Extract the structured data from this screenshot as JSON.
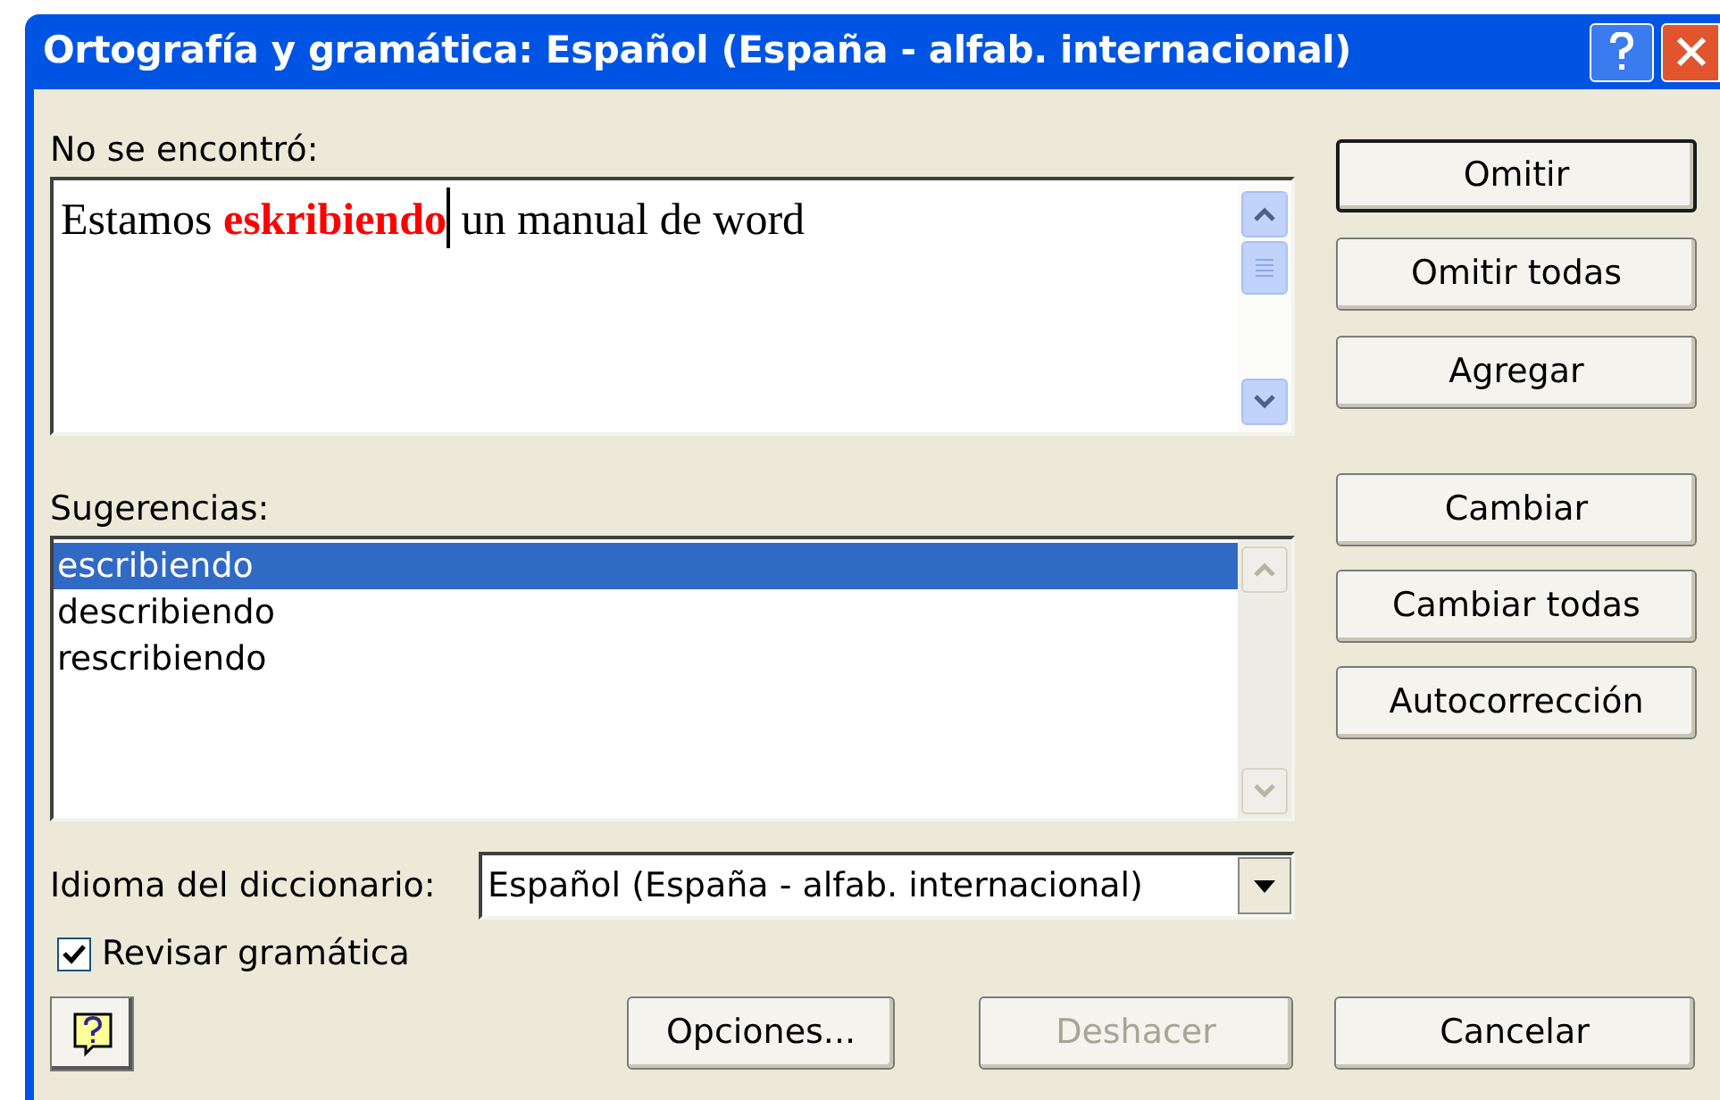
{
  "window": {
    "title": "Ortografía y gramática: Español (España - alfab. internacional)"
  },
  "not_found": {
    "label": "No se encontró:",
    "text_before": "Estamos ",
    "error_word": "eskribiendo",
    "text_after": " un manual de word"
  },
  "side_buttons_top": [
    {
      "label": "Omitir",
      "default": true
    },
    {
      "label": "Omitir todas",
      "default": false
    },
    {
      "label": "Agregar",
      "default": false
    }
  ],
  "suggestions": {
    "label": "Sugerencias:",
    "items": [
      {
        "text": "escribiendo",
        "selected": true
      },
      {
        "text": "describiendo",
        "selected": false
      },
      {
        "text": "rescribiendo",
        "selected": false
      }
    ]
  },
  "side_buttons_bottom": [
    {
      "label": "Cambiar",
      "default": false
    },
    {
      "label": "Cambiar todas",
      "default": false
    },
    {
      "label": "Autocorrección",
      "default": false
    }
  ],
  "dictionary": {
    "label": "Idioma del diccionario:",
    "value": "Español (España - alfab. internacional)"
  },
  "check_grammar": {
    "label": "Revisar gramática",
    "checked": true
  },
  "bottom_buttons": [
    {
      "label": "Opciones...",
      "disabled": false
    },
    {
      "label": "Deshacer",
      "disabled": true
    },
    {
      "label": "Cancelar",
      "disabled": false
    }
  ]
}
